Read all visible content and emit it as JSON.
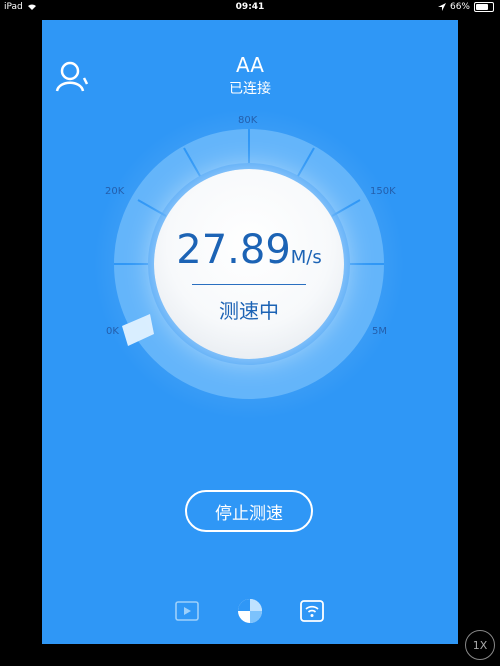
{
  "statusbar": {
    "device": "iPad",
    "time": "09:41",
    "battery": "66%"
  },
  "header": {
    "title": "AA",
    "subtitle": "已连接"
  },
  "gauge": {
    "labels": [
      "0K",
      "20K",
      "80K",
      "150K",
      "5M"
    ],
    "speed_value": "27.89",
    "speed_unit": "M/s",
    "status": "测速中"
  },
  "actions": {
    "stop_label": "停止测速"
  },
  "toolbar": {
    "icons": [
      "video-icon",
      "speedtest-icon",
      "wifi-icon"
    ]
  },
  "zoom": {
    "label": "1X"
  },
  "colors": {
    "background": "#2f97f6",
    "dial_text": "#1c63b5"
  }
}
